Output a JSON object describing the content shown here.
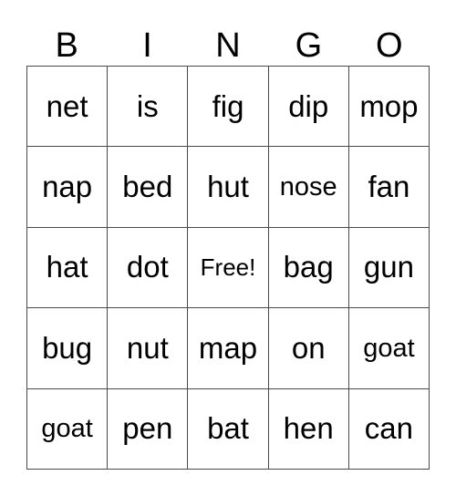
{
  "card": {
    "title": "BINGO",
    "free_space_label": "Free!",
    "columns": [
      "B",
      "I",
      "N",
      "G",
      "O"
    ],
    "grid_size": "5x5",
    "text_color": "#000000",
    "border_color": "#4a4a4a",
    "background_color": "#ffffff",
    "rows": [
      [
        "net",
        "is",
        "fig",
        "dip",
        "mop"
      ],
      [
        "nap",
        "bed",
        "hut",
        "nose",
        "fan"
      ],
      [
        "hat",
        "dot",
        "Free!",
        "bag",
        "gun"
      ],
      [
        "bug",
        "nut",
        "map",
        "on",
        "goat"
      ],
      [
        "goat",
        "pen",
        "bat",
        "hen",
        "can"
      ]
    ]
  }
}
